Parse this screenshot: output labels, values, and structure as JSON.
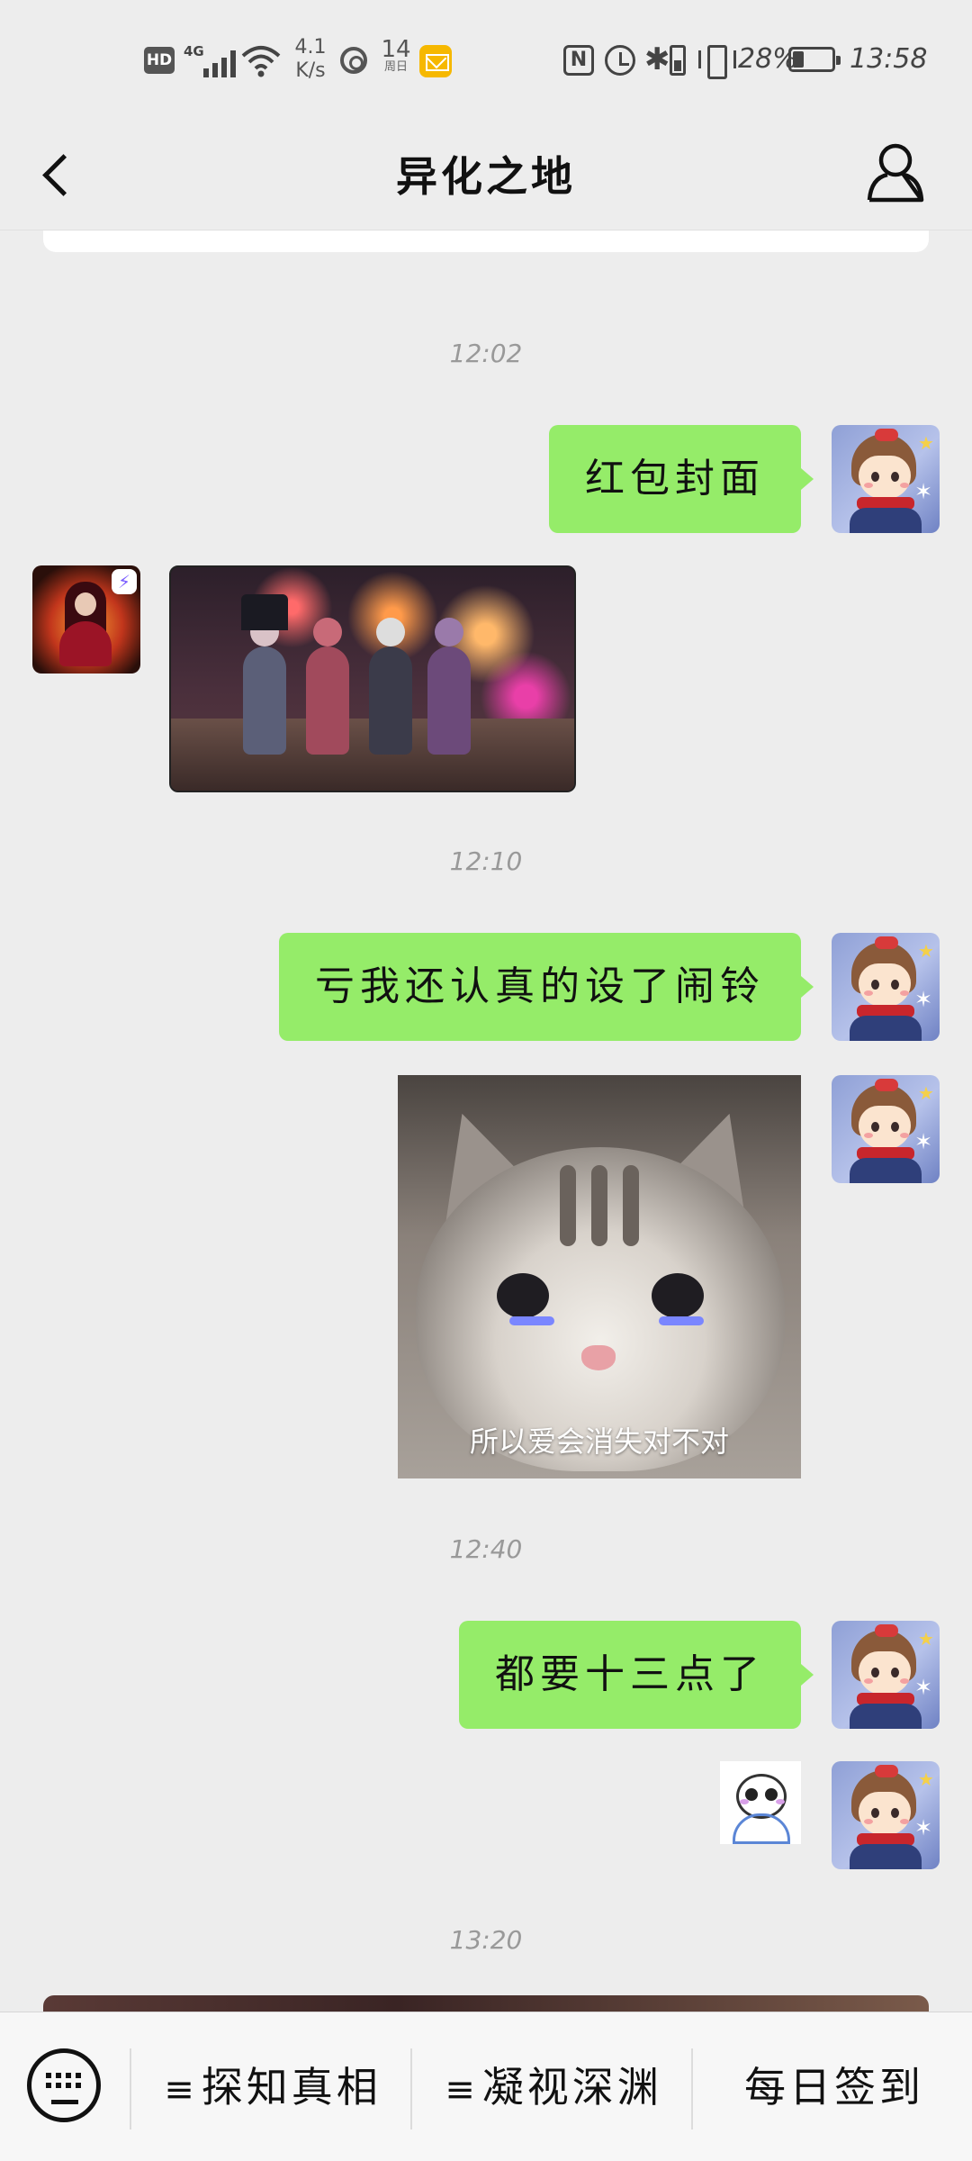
{
  "status_bar": {
    "hd": "HD",
    "network": "4G",
    "speed_value": "4.1",
    "speed_unit": "K/s",
    "weather_num": "14",
    "weather_sub": "周日",
    "nfc": "N",
    "battery_percent_text": "28%",
    "battery_level": 0.28,
    "time": "13:58"
  },
  "header": {
    "title": "异化之地"
  },
  "messages": {
    "ts1": "12:02",
    "m1_text": "红包封面",
    "ts2": "12:10",
    "m2_text": "亏我还认真的设了闹铃",
    "cat_caption": "所以爱会消失对不对",
    "ts3": "12:40",
    "m3_text": "都要十三点了",
    "ts4": "13:20"
  },
  "menu": {
    "item1": "探知真相",
    "item2": "凝视深渊",
    "item3": "每日签到",
    "lines_glyph": "≡"
  },
  "colors": {
    "bubble_me": "#95ec69",
    "background": "#ededed"
  }
}
